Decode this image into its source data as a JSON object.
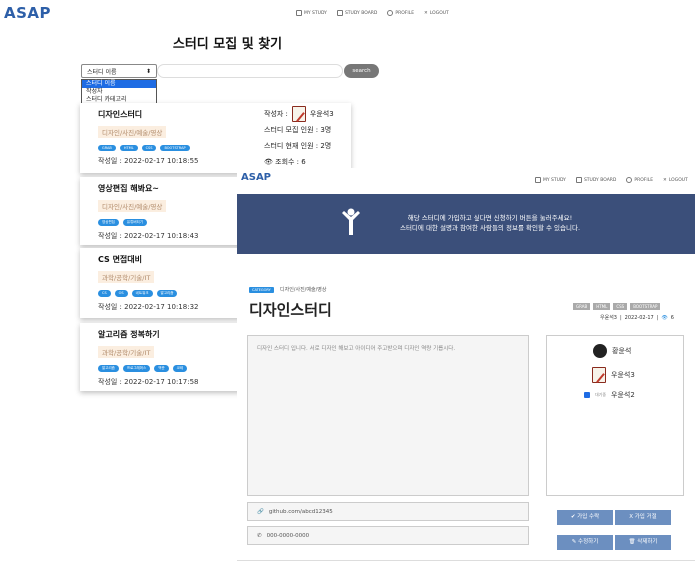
{
  "app": {
    "logo": "ASAP"
  },
  "nav": {
    "my_study": "MY STUDY",
    "study_board": "STUDY BOARD",
    "profile": "PROFILE",
    "logout": "LOGOUT"
  },
  "list_page": {
    "title": "스터디 모집 및 찾기",
    "filter": {
      "selected": "스터디 이름",
      "options": [
        "스터디 이름",
        "작성자",
        "스터디 카테고리"
      ]
    },
    "search_button": "search",
    "cards": [
      {
        "name": "디자인스터디",
        "category": "디자인/사진/예술/영상",
        "tags": [
          "GRAB",
          "HTML",
          "CSS",
          "BOOTSTRAP"
        ],
        "date": "작성일 : 2022-02-17 10:18:55"
      },
      {
        "name": "영상편집 해봐요~",
        "category": "디자인/사진/예술/영상",
        "tags": [
          "영상편집",
          "유튜버되기"
        ],
        "date": "작성일 : 2022-02-17 10:18:43"
      },
      {
        "name": "CS 면접대비",
        "category": "과학/공학/기술/IT",
        "tags": [
          "CS",
          "OS",
          "네트워크",
          "알고리즘"
        ],
        "date": "작성일 : 2022-02-17 10:18:32"
      },
      {
        "name": "알고리즘 정복하기",
        "category": "과학/공학/기술/IT",
        "tags": [
          "알고리즘",
          "프로그래머스",
          "백준",
          "코테"
        ],
        "date": "작성일 : 2022-02-17 10:17:58"
      }
    ],
    "card1_info": {
      "writer_label": "작성자 :",
      "writer": "우윤석3",
      "max_members": "스터디 모집 인원 : 3명",
      "current_members": "스터디 현재 인원 : 2명",
      "views": "조회수 : 6"
    }
  },
  "detail_page": {
    "banner_line1": "해당 스터디에 가입하고 싶다면 신청하기 버튼을 눌러주세요!",
    "banner_line2": "스터디에 대한 설명과 참여한 사람들의 정보를 확인할 수 있습니다.",
    "category_badge": "CATEGORY",
    "category": "디자인/사진/예술/영상",
    "title": "디자인스터디",
    "tags": [
      "GRAB",
      "HTML",
      "CSS",
      "BOOTSTRAP"
    ],
    "writer": "우윤석3",
    "date": "2022-02-17",
    "views": "6",
    "description": "디자인 스터디 입니다. 서로 디자인 해보고 아이디어 주고받으며 디자인 역량 기릅시다.",
    "members": [
      {
        "name": "황윤석"
      },
      {
        "name": "우윤석3"
      },
      {
        "name": "우윤석2",
        "note": "대기중"
      }
    ],
    "github": "github.com/abcd12345",
    "phone": "000-0000-0000",
    "buttons": {
      "accept": "✔ 가입 수락",
      "reject": "X 가입 거절",
      "edit": "✎ 수정하기",
      "delete": "🗑 삭제하기"
    }
  },
  "colors": {
    "brand": "#2d5fa8",
    "banner": "#3b4f7a",
    "tag": "#2a8fe0",
    "button": "#6c8fc0"
  }
}
